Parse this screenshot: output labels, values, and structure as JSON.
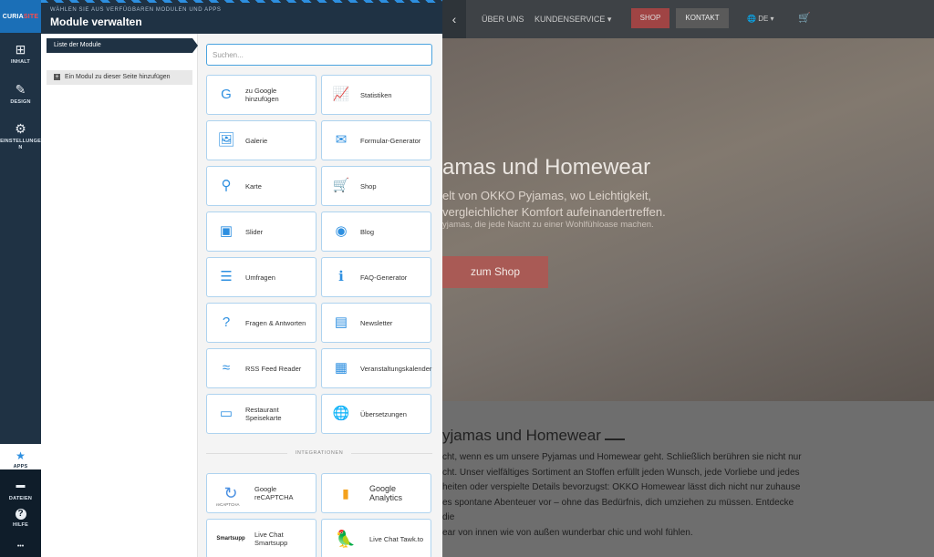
{
  "rail": {
    "logo_a": "CURIA",
    "logo_b": "SITE",
    "items": [
      {
        "icon": "plus-square-icon",
        "glyph": "⊞",
        "label": "INHALT"
      },
      {
        "icon": "brush-icon",
        "glyph": "✎",
        "label": "DESIGN"
      },
      {
        "icon": "gears-icon",
        "glyph": "⚙",
        "label": "EINSTELLUNGE N"
      }
    ],
    "bottom": [
      {
        "icon": "star-icon",
        "glyph": "★",
        "label": "APPS"
      },
      {
        "icon": "folder-icon",
        "glyph": "▬",
        "label": "DATEIEN"
      },
      {
        "icon": "help-icon",
        "glyph": "?",
        "label": "HILFE"
      },
      {
        "icon": "more-icon",
        "glyph": "•••",
        "label": ""
      }
    ]
  },
  "panel": {
    "subtitle": "WÄHLEN SIE AUS VERFÜGBAREN MODULEN UND APPS",
    "title": "Module verwalten",
    "list_tab": "Liste der Module",
    "add_module": "Ein Modul zu dieser Seite hinzufügen",
    "search_placeholder": "Suchen...",
    "modules": [
      {
        "label": "zu Google hinzufügen",
        "icon": "google-icon",
        "glyph": "G"
      },
      {
        "label": "Statistiken",
        "icon": "chart-line-icon",
        "glyph": "📈"
      },
      {
        "label": "Galerie",
        "icon": "gallery-icon",
        "glyph": "🖼"
      },
      {
        "label": "Formular-Generator",
        "icon": "envelope-icon",
        "glyph": "✉"
      },
      {
        "label": "Karte",
        "icon": "map-marker-icon",
        "glyph": "⚲"
      },
      {
        "label": "Shop",
        "icon": "cart-icon",
        "glyph": "🛒"
      },
      {
        "label": "Slider",
        "icon": "slider-image-icon",
        "glyph": "▣"
      },
      {
        "label": "Blog",
        "icon": "podcast-icon",
        "glyph": "◉"
      },
      {
        "label": "Umfragen",
        "icon": "list-check-icon",
        "glyph": "☰"
      },
      {
        "label": "FAQ-Generator",
        "icon": "info-icon",
        "glyph": "ℹ"
      },
      {
        "label": "Fragen & Antworten",
        "icon": "question-icon",
        "glyph": "?"
      },
      {
        "label": "Newsletter",
        "icon": "newspaper-icon",
        "glyph": "▤"
      },
      {
        "label": "RSS Feed Reader",
        "icon": "rss-icon",
        "glyph": "≈"
      },
      {
        "label": "Veranstaltungskalender",
        "icon": "calendar-icon",
        "glyph": "▦"
      },
      {
        "label": "Restaurant Speisekarte",
        "icon": "folder-open-icon",
        "glyph": "▭"
      },
      {
        "label": "Übersetzungen",
        "icon": "globe-icon",
        "glyph": "🌐"
      }
    ],
    "integrations_label": "INTEGRATIONEN",
    "integrations": [
      {
        "brand": "reCAPTCHA",
        "label": "Google reCAPTCHA",
        "icon": "recaptcha-icon",
        "glyph": "↻"
      },
      {
        "brand": "",
        "label": "Google Analytics",
        "icon": "analytics-icon",
        "glyph": "▮"
      },
      {
        "brand": "Smartsupp",
        "label": "Live Chat Smartsupp",
        "icon": "smartsupp-logo",
        "glyph": ""
      },
      {
        "brand": "",
        "label": "Live Chat Tawk.to",
        "icon": "tawk-parrot-icon",
        "glyph": "🦜"
      }
    ]
  },
  "site": {
    "nav_back": "‹",
    "nav": [
      "ÜBER UNS",
      "KUNDENSERVICE ▾"
    ],
    "shop": "SHOP",
    "kontakt": "KONTAKT",
    "lang": "DE ▾",
    "hero_title": "amas und Homewear",
    "hero_line1": "elt von OKKO Pyjamas, wo Leichtigkeit,",
    "hero_line2": "vergleichlicher Komfort aufeinandertreffen.",
    "hero_line3": "yjamas, die jede Nacht zu einer Wohlfühloase machen.",
    "hero_button": "zum Shop",
    "section_title": "yjamas und Homewear",
    "para": [
      "cht, wenn es um unsere Pyjamas und Homewear geht. Schließlich berühren sie nicht nur",
      "cht. Unser vielfältiges Sortiment an  Stoffen erfüllt jeden Wunsch, jede Vorliebe und jedes",
      "heiten oder verspielte Details bevorzugst: OKKO Homewear lässt dich nicht nur zuhause",
      "es spontane Abenteuer vor – ohne das Bedürfnis, dich umziehen zu müssen. Entdecke die",
      "ear von innen wie von außen wunderbar chic und wohl fühlen."
    ]
  }
}
